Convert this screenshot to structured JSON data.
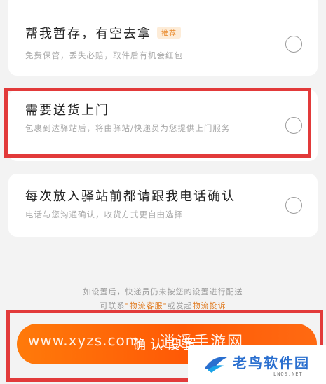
{
  "options": [
    {
      "title": "帮我暂存，有空去拿",
      "badge": "推荐",
      "desc": "免费保管，丢失必赔，取件后有机会红包",
      "selected": false
    },
    {
      "title": "需要送货上门",
      "desc": "包裹到达驿站后，将由驿站/快递员为您提供上门服务",
      "selected": false
    },
    {
      "title": "每次放入驿站前都请跟我电话确认",
      "desc": "电话与您沟通确认，收货方式更自由选择",
      "selected": false
    }
  ],
  "footer": {
    "note": "如设置后，快递员仍未按您的设置进行配送",
    "note2_prefix": "可联系",
    "note2_link": "\"物流客服\"",
    "note2_mid": "或发起",
    "note2_link2": "物流投诉"
  },
  "confirm_button_label": "确认设置",
  "watermark": {
    "url": "www.xyzs.com",
    "name": "逍遥手游网"
  },
  "logo": {
    "name": "老鸟软件园",
    "sub": "LNQS.NET"
  },
  "colors": {
    "accent": "#ff6a10",
    "highlight_border": "#e23a3a",
    "badge_text": "#e98a2b"
  }
}
